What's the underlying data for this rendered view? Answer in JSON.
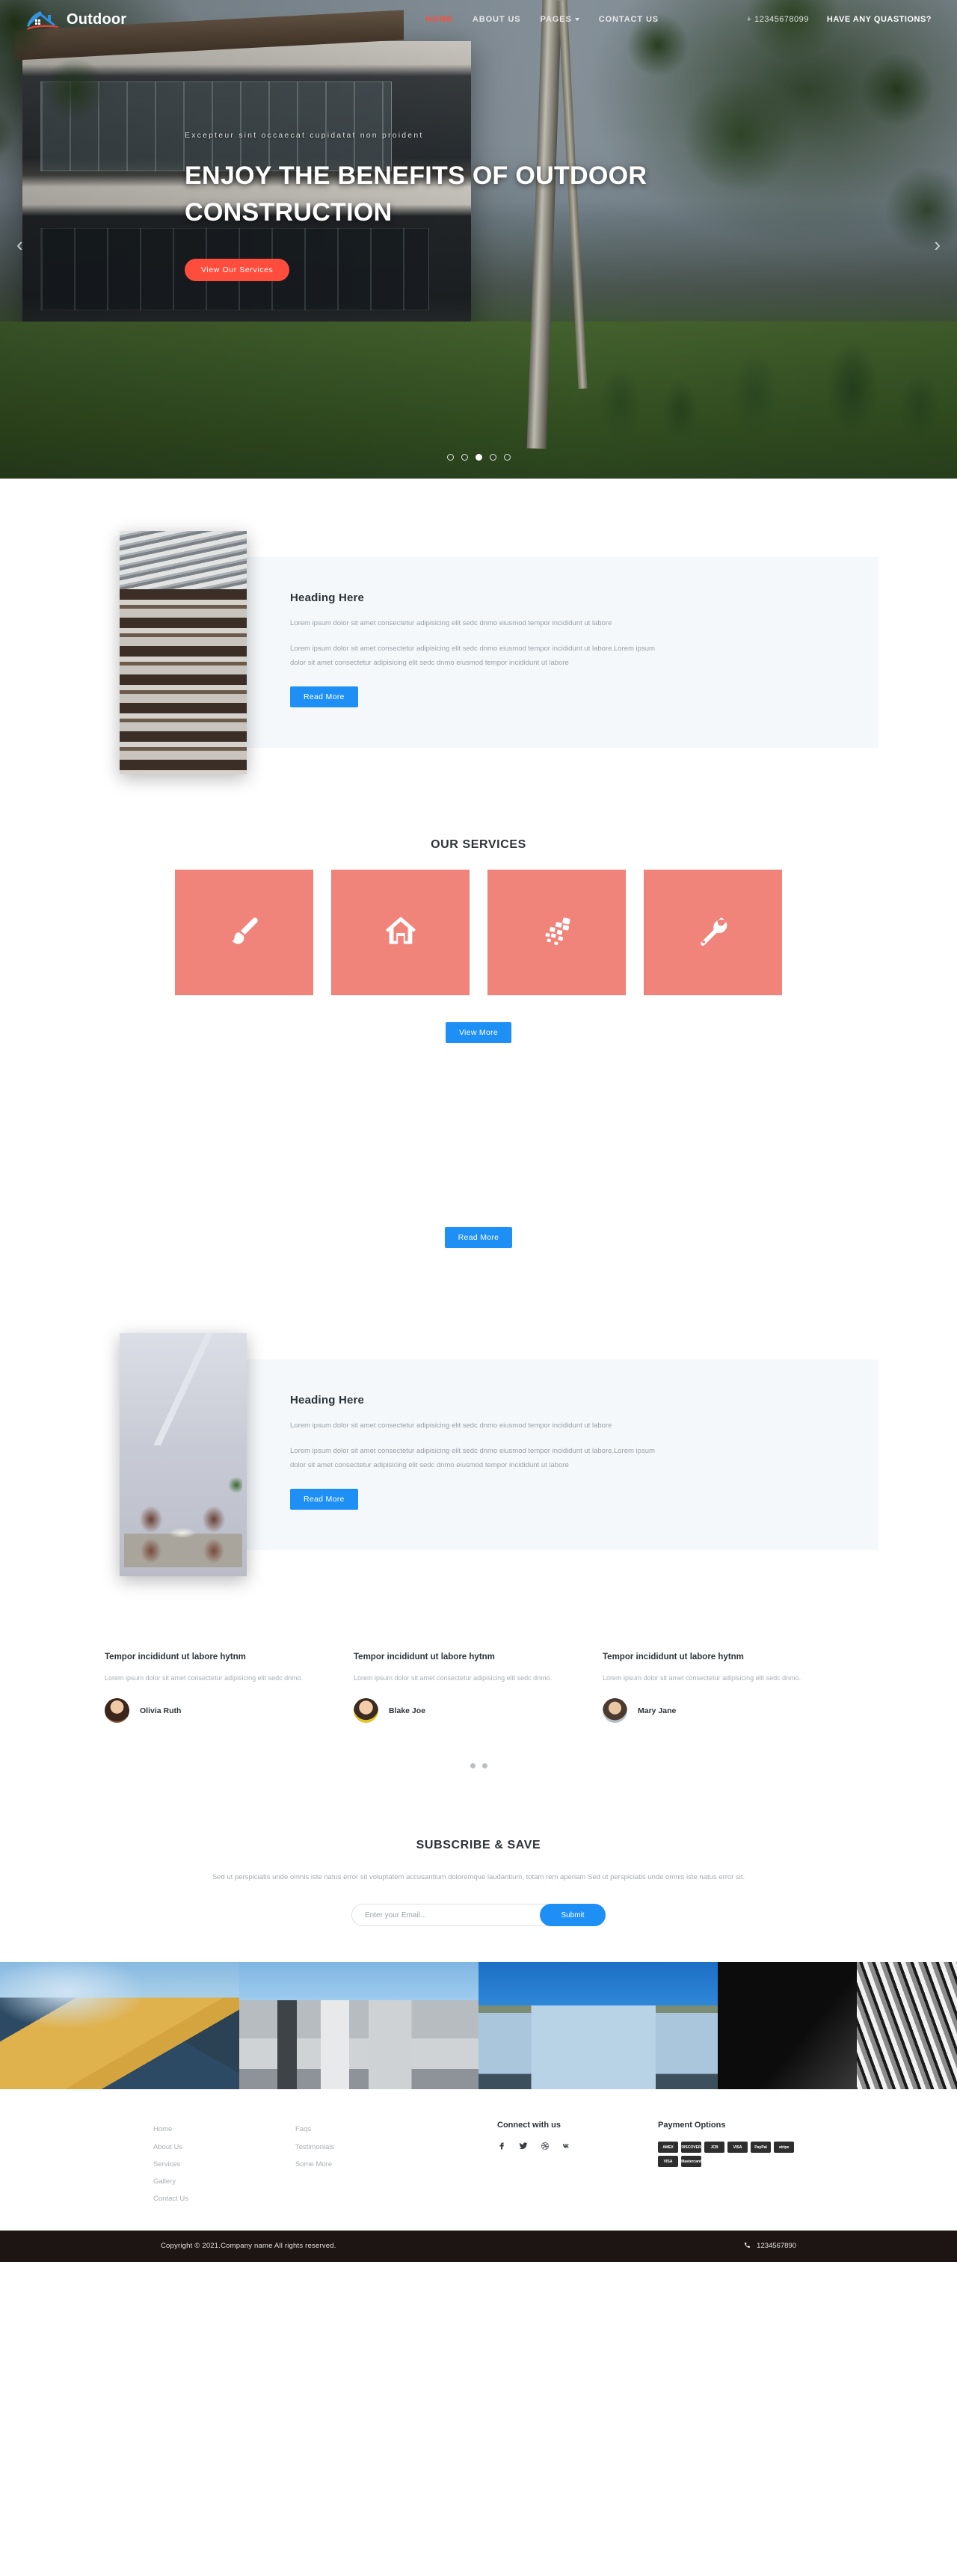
{
  "brand": {
    "name": "Outdoor",
    "logo_icon": "house-roof-logo"
  },
  "nav": {
    "items": [
      {
        "label": "HOME",
        "active": true
      },
      {
        "label": "ABOUT US",
        "active": false
      },
      {
        "label": "PAGES",
        "active": false,
        "has_dropdown": true
      },
      {
        "label": "CONTACT US",
        "active": false
      }
    ],
    "phone": "+ 12345678099",
    "questions": "HAVE ANY QUASTIONS?"
  },
  "hero": {
    "eyebrow": "Excepteur sint occaecat cupidatat non proident",
    "title": "ENJOY THE BENEFITS OF OUTDOOR CONSTRUCTION",
    "button": "View Our Services",
    "prev_arrow": "‹",
    "next_arrow": "›",
    "slides_total": 5,
    "active_slide": 3,
    "accent_color": "#ff4d3d"
  },
  "feature1": {
    "heading": "Heading Here",
    "paragraph1": "Lorem ipsum dolor sit amet consectetur adipisicing elit sedc dnmo eiusmod tempor incididunt ut labore",
    "paragraph2": "Lorem ipsum dolor sit amet consectetur adipisicing elit sedc dnmo eiusmod tempor incididunt ut labore.Lorem ipsum dolor sit amet consectetur adipisicing elit sedc dnmo eiusmod tempor incididunt ut labore",
    "button": "Read More",
    "image_alt": "layered-gray-building"
  },
  "services": {
    "title": "OUR SERVICES",
    "cards": [
      {
        "icon": "paint-brush-icon"
      },
      {
        "icon": "home-icon"
      },
      {
        "icon": "bricks-icon"
      },
      {
        "icon": "wrench-icon"
      }
    ],
    "button": "View More",
    "card_color": "#f0837a"
  },
  "gallery": {
    "button": "Read More"
  },
  "feature2": {
    "heading": "Heading Here",
    "paragraph1": "Lorem ipsum dolor sit amet consectetur adipisicing elit sedc dnmo eiusmod tempor incididunt ut labore",
    "paragraph2": "Lorem ipsum dolor sit amet consectetur adipisicing elit sedc dnmo eiusmod tempor incididunt ut labore.Lorem ipsum dolor sit amet consectetur adipisicing elit sedc dnmo eiusmod tempor incididunt ut labore",
    "button": "Read More",
    "image_alt": "interior-dining-room"
  },
  "testimonials": {
    "items": [
      {
        "heading": "Tempor incididunt ut labore hytnm",
        "text": "Lorem ipsum dolor sit amet consectetur adipisicing elit sedc dnmo.",
        "name": "Olivia Ruth"
      },
      {
        "heading": "Tempor incididunt ut labore hytnm",
        "text": "Lorem ipsum dolor sit amet consectetur adipisicing elit sedc dnmo.",
        "name": "Blake Joe"
      },
      {
        "heading": "Tempor incididunt ut labore hytnm",
        "text": "Lorem ipsum dolor sit amet consectetur adipisicing elit sedc dnmo.",
        "name": "Mary Jane"
      }
    ],
    "dots_total": 2
  },
  "subscribe": {
    "title": "SUBSCRIBE & SAVE",
    "text": "Sed ut perspiciatis unde omnis iste natus error sit voluptatem accusantium doloremque laudantium, totam rem aperiam Sed ut perspiciatis unde omnis iste natus error sit.",
    "input_placeholder": "Enter your Email...",
    "input_value": "",
    "button": "Submit"
  },
  "strip": {
    "images": [
      {
        "alt": "golden-dome-pavilion"
      },
      {
        "alt": "curved-city-hall-tower"
      },
      {
        "alt": "blue-victorian-storefront"
      },
      {
        "alt": "black-white-fanned-facade"
      }
    ]
  },
  "footer": {
    "links_col1": [
      "Home",
      "About Us",
      "Services",
      "Gallery",
      "Contact Us"
    ],
    "links_col2": [
      "Faqs",
      "Testimonials",
      "Some More"
    ],
    "connect_title": "Connect with us",
    "socials": [
      "facebook-icon",
      "twitter-icon",
      "dribbble-icon",
      "vk-icon"
    ],
    "payment_title": "Payment Options",
    "payments": [
      "AMEX",
      "DISCOVER",
      "JCB",
      "VISA",
      "PayPal",
      "stripe",
      "VISA",
      "Mastercard"
    ],
    "copyright": "Copyright © 2021.Company name All rights reserved.",
    "phone": "1234567890",
    "phone_icon": "phone-icon"
  }
}
